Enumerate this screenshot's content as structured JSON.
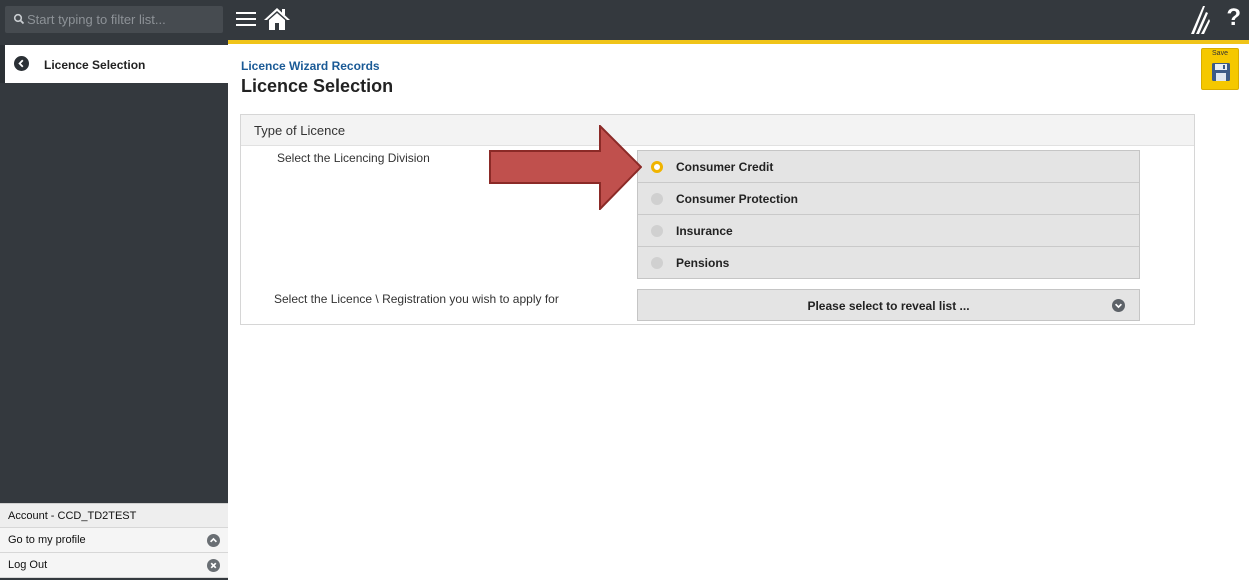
{
  "search": {
    "placeholder": "Start typing to filter list..."
  },
  "sidebar": {
    "active_item": "Licence Selection",
    "account_label": "Account - CCD_TD2TEST",
    "profile_label": "Go to my profile",
    "logout_label": "Log Out"
  },
  "topbar": {
    "help_label": "?"
  },
  "save": {
    "label": "Save"
  },
  "header": {
    "breadcrumb": "Licence Wizard Records",
    "title": "Licence Selection"
  },
  "panel": {
    "title": "Type of Licence",
    "division_label": "Select the Licencing Division",
    "licence_label": "Select the Licence \\ Registration you wish to apply for",
    "options": [
      {
        "label": "Consumer Credit",
        "selected": true
      },
      {
        "label": "Consumer Protection",
        "selected": false
      },
      {
        "label": "Insurance",
        "selected": false
      },
      {
        "label": "Pensions",
        "selected": false
      }
    ],
    "select_placeholder": "Please select to reveal list ..."
  },
  "colors": {
    "sidebar": "#34393e",
    "accent_yellow": "#f0c419",
    "link_blue": "#1a5a96",
    "arrow_red": "#c0504d"
  }
}
